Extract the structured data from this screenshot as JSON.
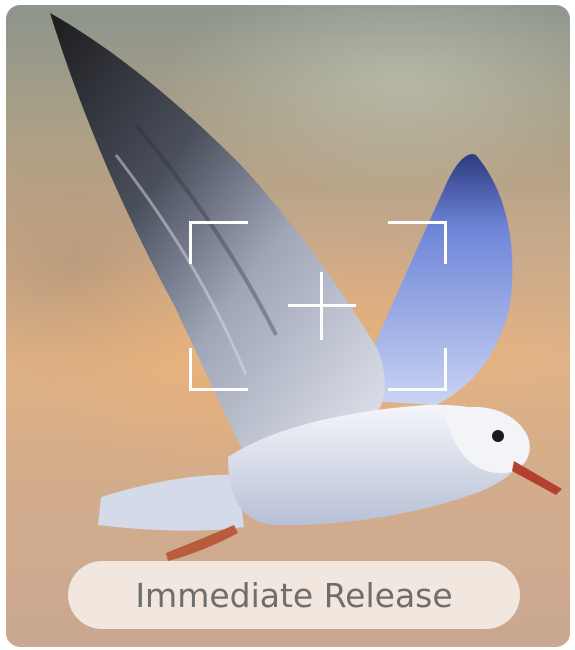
{
  "release_button": {
    "label": "Immediate Release"
  },
  "photo": {
    "subject_icon": "seagull-in-flight-photo"
  },
  "overlay": {
    "frame_icon": "focus-frame-icon",
    "crosshair_icon": "crosshair-icon"
  },
  "colors": {
    "button_bg": "#f4ece4",
    "button_text": "#6e6e6e",
    "overlay": "#ffffff"
  }
}
